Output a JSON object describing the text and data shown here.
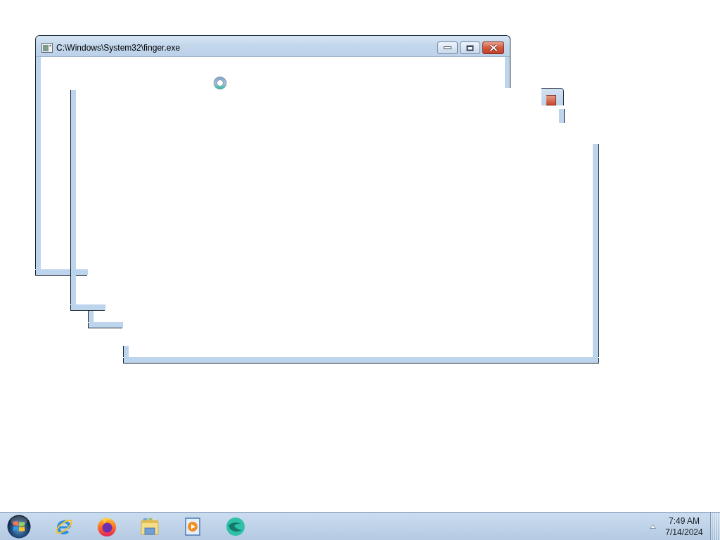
{
  "window": {
    "title": "C:\\Windows\\System32\\finger.exe"
  },
  "taskbar": {
    "clock": {
      "time": "7:49 AM",
      "date": "7/14/2024"
    }
  }
}
